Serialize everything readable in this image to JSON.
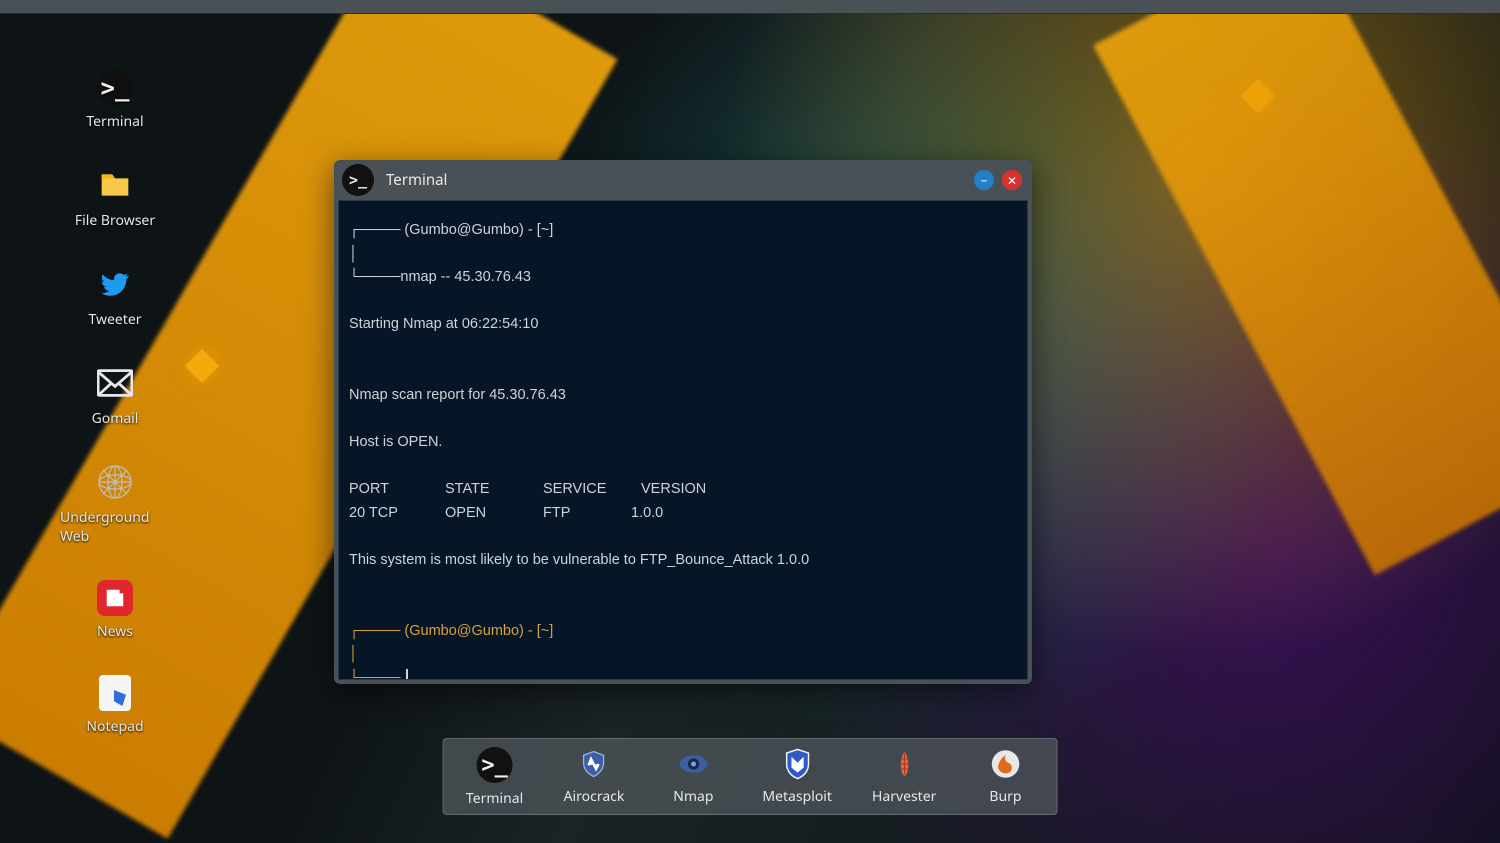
{
  "desktop_icons": [
    {
      "name": "terminal",
      "label": "Terminal"
    },
    {
      "name": "file-browser",
      "label": "File Browser"
    },
    {
      "name": "tweeter",
      "label": "Tweeter"
    },
    {
      "name": "gomail",
      "label": "Gomail"
    },
    {
      "name": "underground-web",
      "label": "Underground Web"
    },
    {
      "name": "news",
      "label": "News"
    },
    {
      "name": "notepad",
      "label": "Notepad"
    }
  ],
  "window": {
    "title": "Terminal",
    "prompt1_user": "(Gumbo@Gumbo) - [~]",
    "command": "nmap -- 45.30.76.43",
    "line_start": "Starting Nmap at 06:22:54:10",
    "line_report": "Nmap scan report for 45.30.76.43",
    "line_host": "Host is OPEN.",
    "col_port": "PORT",
    "col_state": "STATE",
    "col_service": "SERVICE",
    "col_version": "VERSION",
    "row_port": "20 TCP",
    "row_state": "OPEN",
    "row_service": "FTP",
    "row_version": "1.0.0",
    "line_vuln": "This system is most likely to be vulnerable to FTP_Bounce_Attack 1.0.0",
    "prompt2_user": "(Gumbo@Gumbo) - [~]"
  },
  "dock": [
    {
      "name": "terminal",
      "label": "Terminal"
    },
    {
      "name": "airocrack",
      "label": "Airocrack"
    },
    {
      "name": "nmap",
      "label": "Nmap"
    },
    {
      "name": "metasploit",
      "label": "Metasploit"
    },
    {
      "name": "harvester",
      "label": "Harvester"
    },
    {
      "name": "burp",
      "label": "Burp"
    }
  ]
}
